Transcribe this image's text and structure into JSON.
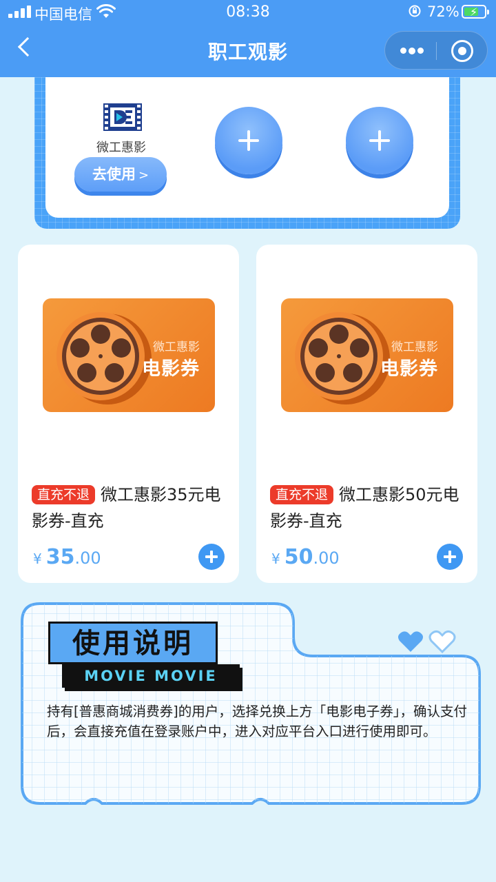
{
  "status_bar": {
    "carrier": "中国电信",
    "time": "08:38",
    "battery": "72%",
    "battery_level": 0.72
  },
  "nav": {
    "title": "职工观影"
  },
  "platform": {
    "name": "微工惠影",
    "use_label": "去使用",
    "use_chevron": ">"
  },
  "products": [
    {
      "tag": "直充不退",
      "title": "微工惠影35元电影券-直充",
      "banner_sub": "微工惠影",
      "banner_main": "电影券",
      "currency": "¥",
      "price_int": "35",
      "price_dec": ".00"
    },
    {
      "tag": "直充不退",
      "title": "微工惠影50元电影券-直充",
      "banner_sub": "微工惠影",
      "banner_main": "电影券",
      "currency": "¥",
      "price_int": "50",
      "price_dec": ".00"
    }
  ],
  "instructions": {
    "title": "使用说明",
    "subtitle": "MOVIE MOVIE",
    "text": "持有[普惠商城消费券]的用户，选择兑换上方「电影电子券」，确认支付后，会直接充值在登录账户中，进入对应平台入口进行使用即可。"
  },
  "colors": {
    "nav_bg": "#4b9cf5",
    "page_bg": "#dff3fb",
    "accent_blue": "#5aa8f3",
    "tag_red": "#ec3b2a",
    "banner_orange": "#ef8127"
  }
}
